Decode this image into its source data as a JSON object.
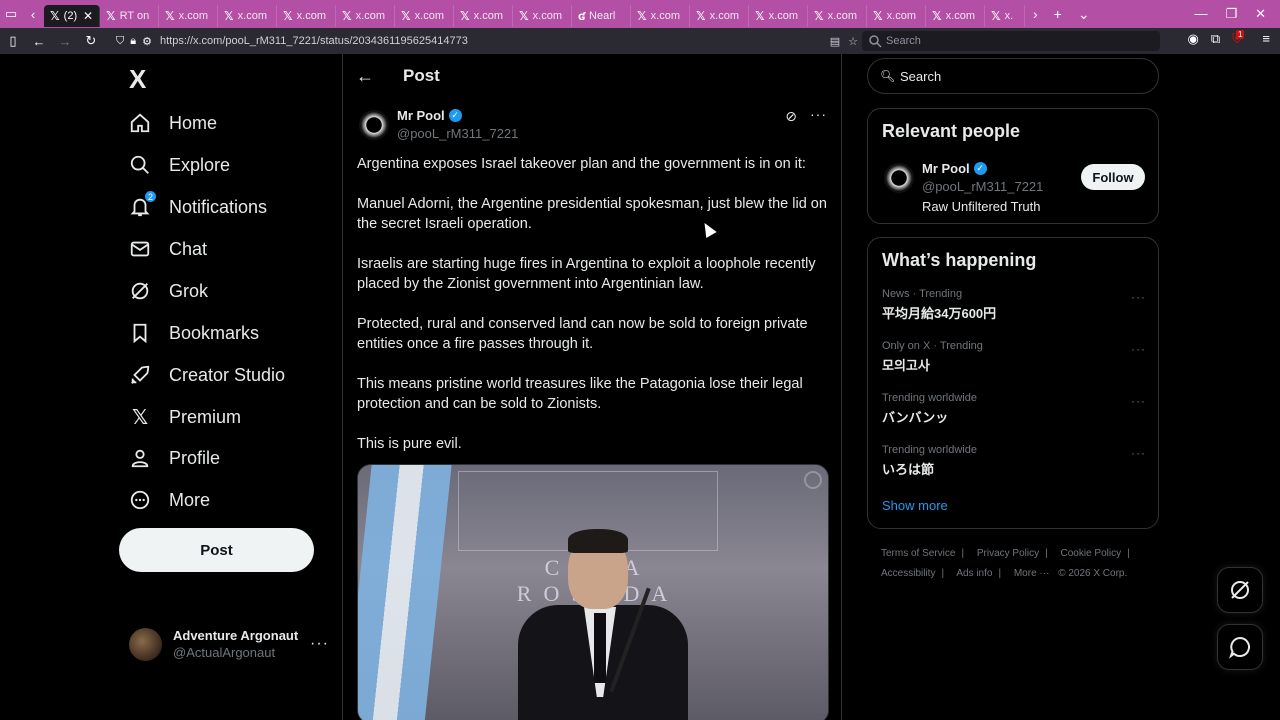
{
  "browser": {
    "tabs": [
      {
        "label": "(2)",
        "active": true
      },
      {
        "label": "RT on"
      },
      {
        "label": "x.com"
      },
      {
        "label": "x.com"
      },
      {
        "label": "x.com"
      },
      {
        "label": "x.com"
      },
      {
        "label": "x.com"
      },
      {
        "label": "x.com"
      },
      {
        "label": "x.com"
      },
      {
        "label": "Nearl"
      },
      {
        "label": "x.com"
      },
      {
        "label": "x.com"
      },
      {
        "label": "x.com"
      },
      {
        "label": "x.com"
      },
      {
        "label": "x.com"
      },
      {
        "label": "x.com"
      },
      {
        "label": "x."
      }
    ],
    "url": "https://x.com/pooL_rM311_7221/status/2034361195625414773",
    "search_placeholder": "Search",
    "extension_badge": "1",
    "accent": "#b44fa6"
  },
  "sidebar": {
    "logo": "X",
    "items": [
      {
        "label": "Home",
        "icon": "home-icon"
      },
      {
        "label": "Explore",
        "icon": "search-icon"
      },
      {
        "label": "Notifications",
        "icon": "bell-icon",
        "badge": "2"
      },
      {
        "label": "Chat",
        "icon": "mail-icon"
      },
      {
        "label": "Grok",
        "icon": "grok-icon"
      },
      {
        "label": "Bookmarks",
        "icon": "bookmark-icon"
      },
      {
        "label": "Creator Studio",
        "icon": "rocket-icon"
      },
      {
        "label": "Premium",
        "icon": "x-icon"
      },
      {
        "label": "Profile",
        "icon": "person-icon"
      },
      {
        "label": "More",
        "icon": "more-circle-icon"
      }
    ],
    "post_button": "Post",
    "account": {
      "name": "Adventure Argonaut",
      "handle": "@ActualArgonaut"
    }
  },
  "main": {
    "title": "Post",
    "author": {
      "name": "Mr Pool",
      "handle": "@pooL_rM311_7221"
    },
    "paragraphs": [
      "Argentina exposes Israel takeover plan and the government is in on it:",
      "Manuel Adorni, the Argentine presidential spokesman, just blew the lid on the secret Israeli operation.",
      "Israelis are starting huge fires in Argentina to exploit a loophole recently placed by the Zionist government into Argentinian law.",
      "Protected, rural and conserved land can now be sold to foreign private entities once a fire passes through it.",
      "This means pristine world treasures like the Patagonia lose their legal protection and can be sold to Zionists.",
      "This is pure evil."
    ],
    "media": {
      "sign_text": "CASA ROSADA"
    }
  },
  "right": {
    "search_placeholder": "Search",
    "relevant_people": {
      "heading": "Relevant people",
      "name": "Mr Pool",
      "handle": "@pooL_rM311_7221",
      "bio": "Raw Unfiltered Truth",
      "follow_label": "Follow"
    },
    "happening": {
      "heading": "What’s happening",
      "trends": [
        {
          "meta": "News · Trending",
          "title": "平均月給34万600円"
        },
        {
          "meta": "Only on X · Trending",
          "title": "모의고사"
        },
        {
          "meta": "Trending worldwide",
          "title": "バンバンッ"
        },
        {
          "meta": "Trending worldwide",
          "title": "いろは節"
        }
      ],
      "show_more": "Show more"
    },
    "footer": [
      "Terms of Service",
      "Privacy Policy",
      "Cookie Policy",
      "Accessibility",
      "Ads info",
      "More ···",
      "© 2026 X Corp."
    ]
  },
  "colors": {
    "accent": "#1d9bf0",
    "background": "#000000",
    "border": "#2f3336"
  }
}
